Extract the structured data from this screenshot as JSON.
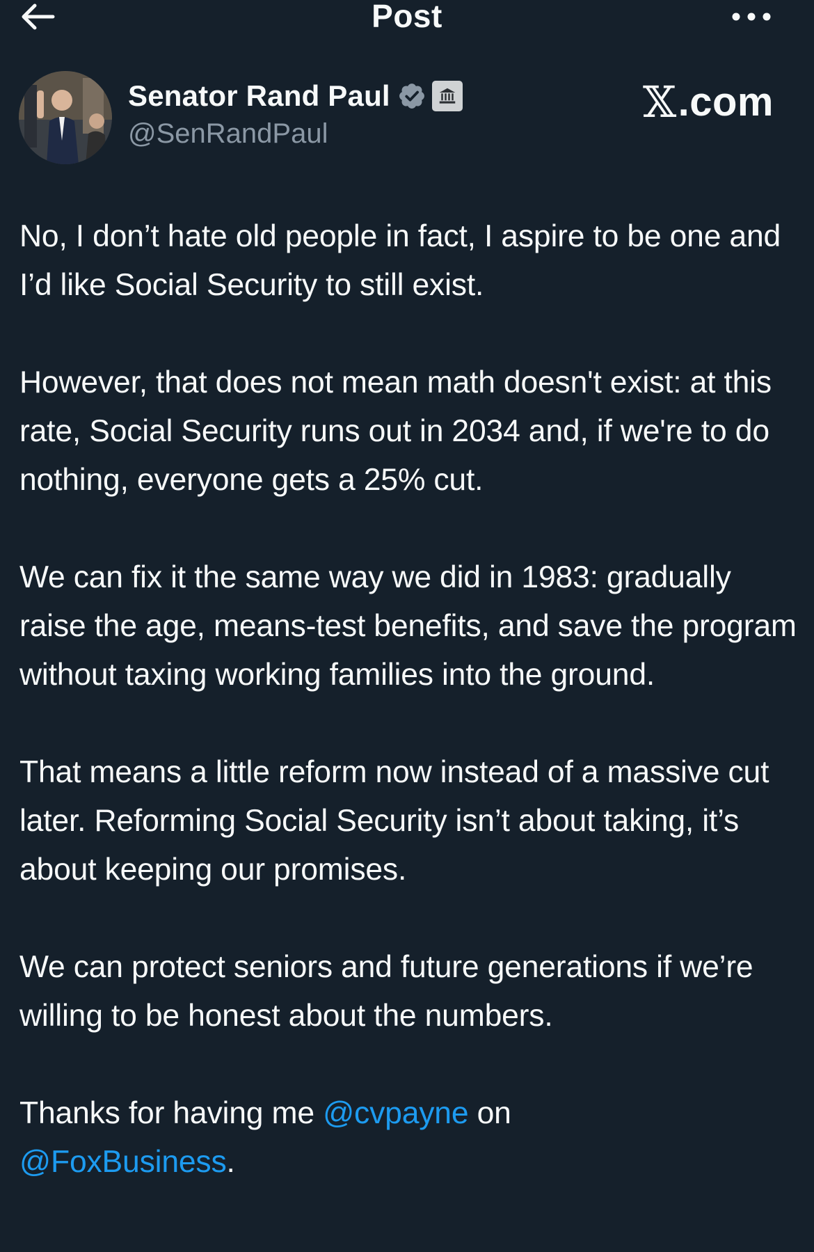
{
  "topbar": {
    "title": "Post",
    "back_icon": "arrow-left-icon",
    "more_icon": "more-horizontal-icon"
  },
  "author": {
    "display_name": "Senator Rand Paul",
    "handle": "@SenRandPaul",
    "verified_icon": "verified-badge-icon",
    "affiliation_icon": "government-building-icon",
    "verified_color": "#8b98a5"
  },
  "watermark": {
    "x": "𝕏",
    "domain": ".com"
  },
  "post": {
    "paragraphs": [
      "No, I don’t hate old people in fact, I aspire to be one and I’d like Social Security to still exist.",
      "However, that does not mean math doesn't exist: at this rate, Social Security runs out in 2034 and, if we're to do nothing, everyone gets a 25% cut.",
      "We can fix it the same way we did in 1983: gradually raise the age, means-test benefits, and save the program without taxing working families into the ground.",
      "That means a little reform now instead of a massive cut later. Reforming Social Security isn’t about taking, it’s about keeping our promises.",
      "We can protect seniors and future generations if we’re willing to be honest about the numbers."
    ],
    "closing": {
      "prefix": "Thanks for having me ",
      "mention1": "@cvpayne",
      "middle": " on",
      "mention2": "@FoxBusiness",
      "suffix": "."
    }
  },
  "colors": {
    "background": "#15202b",
    "text": "#f7f9f9",
    "secondary_text": "#8b98a5",
    "link": "#1d9bf0"
  }
}
